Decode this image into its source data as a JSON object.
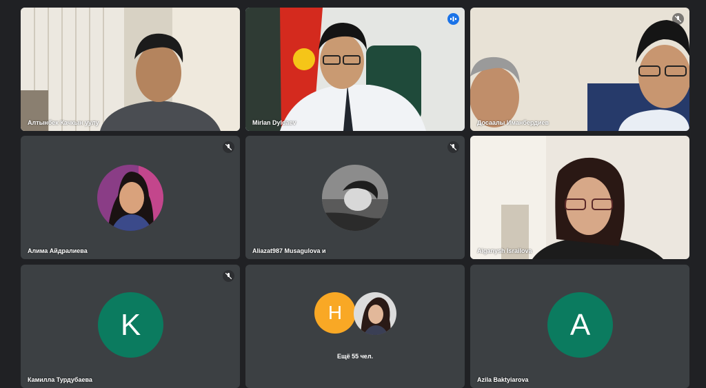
{
  "participants": [
    {
      "name": "Алтынбек Качкын уулу"
    },
    {
      "name": "Mirlan Dyldaev"
    },
    {
      "name": "Досаалы Иманбердиев"
    },
    {
      "name": "Алима Айдралиева"
    },
    {
      "name": "Aliazat987 Musagulova и"
    },
    {
      "name": "Aiganysh Israilova"
    },
    {
      "name": "Камилла Турдубаева",
      "initial": "K"
    },
    {
      "more_label": "Ещё 55 чел.",
      "initial": "H"
    },
    {
      "name": "Azila Baktyiarova",
      "initial": "A"
    }
  ],
  "colors": {
    "tile": "#3c4043",
    "background": "#202124",
    "active_outline": "#8ab4f8",
    "avatar_green": "#0b7b5f",
    "avatar_orange": "#f9a825"
  }
}
